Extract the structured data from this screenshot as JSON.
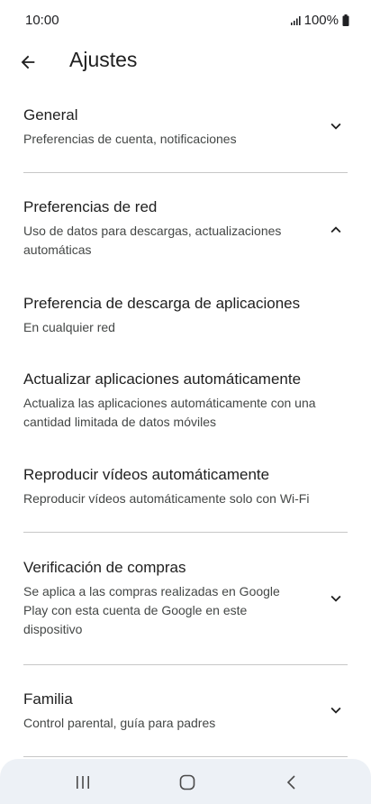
{
  "status_bar": {
    "time": "10:00",
    "battery": "100%",
    "icons": [
      "signal-icon",
      "battery-icon"
    ]
  },
  "app_bar": {
    "title": "Ajustes",
    "back_icon": "arrow-back-icon"
  },
  "sections": [
    {
      "title": "General",
      "subtitle": "Preferencias de cuenta, notificaciones",
      "expanded": false
    },
    {
      "title": "Preferencias de red",
      "subtitle_line1": "Uso de datos para descargas, actualizaciones",
      "subtitle_line2": "automáticas",
      "expanded": true,
      "items": [
        {
          "title": "Preferencia de descarga de aplicaciones",
          "subtitle": "En cualquier red"
        },
        {
          "title": "Actualizar aplicaciones automáticamente",
          "subtitle_line1": "Actualiza las aplicaciones automáticamente con una",
          "subtitle_line2": "cantidad limitada de datos móviles"
        },
        {
          "title": "Reproducir vídeos automáticamente",
          "subtitle": "Reproducir vídeos automáticamente solo con Wi-Fi"
        }
      ]
    },
    {
      "title": "Verificación de compras",
      "subtitle_line1": "Se aplica a las compras realizadas en Google",
      "subtitle_line2": "Play con esta cuenta de Google en este",
      "subtitle_line3": "dispositivo",
      "expanded": false
    },
    {
      "title": "Familia",
      "subtitle": "Control parental, guía para padres",
      "expanded": false
    }
  ],
  "nav_bar": {
    "buttons": [
      "recent-apps-icon",
      "home-icon",
      "back-nav-icon"
    ]
  },
  "colors": {
    "text_primary": "#1f1f1f",
    "text_secondary": "#444746",
    "divider": "#c7c7c7",
    "nav_background": "#edf1f6"
  }
}
